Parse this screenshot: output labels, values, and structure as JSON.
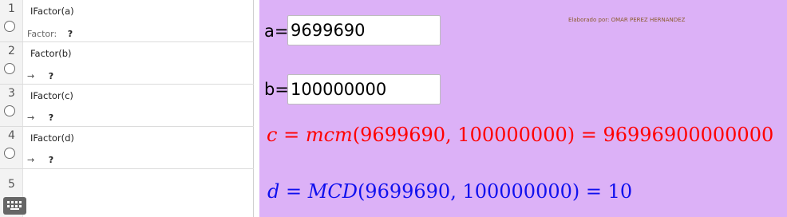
{
  "algebra": {
    "rows": [
      {
        "number": "1",
        "command": "IFactor(a)",
        "output_prefix": "Factor:",
        "output_value": "?"
      },
      {
        "number": "2",
        "command": "Factor(b)",
        "output_prefix": "→",
        "output_value": "?"
      },
      {
        "number": "3",
        "command": "IFactor(c)",
        "output_prefix": "→",
        "output_value": "?"
      },
      {
        "number": "4",
        "command": "IFactor(d)",
        "output_prefix": "→",
        "output_value": "?"
      },
      {
        "number": "5"
      }
    ]
  },
  "graphics": {
    "credit": "Elaborado por: OMAR PEREZ HERNANDEZ",
    "input_a": {
      "label": "a=",
      "value": "9699690"
    },
    "input_b": {
      "label": "b=",
      "value": "100000000"
    },
    "formula_c": {
      "var": "c",
      "eq": " = ",
      "func": "mcm",
      "args": "(9699690, 100000000)",
      "eq2": " = ",
      "result": "96996900000000"
    },
    "formula_d": {
      "var": "d",
      "eq": " = ",
      "func": "MCD",
      "args": "(9699690, 100000000)",
      "eq2": " = ",
      "result": "10"
    }
  },
  "colors": {
    "canvas_background": "#dcb1f7",
    "formula_c": "#ff0000",
    "formula_d": "#1010ee"
  },
  "icons": [
    "visibility-toggle-icon",
    "keyboard-icon"
  ]
}
